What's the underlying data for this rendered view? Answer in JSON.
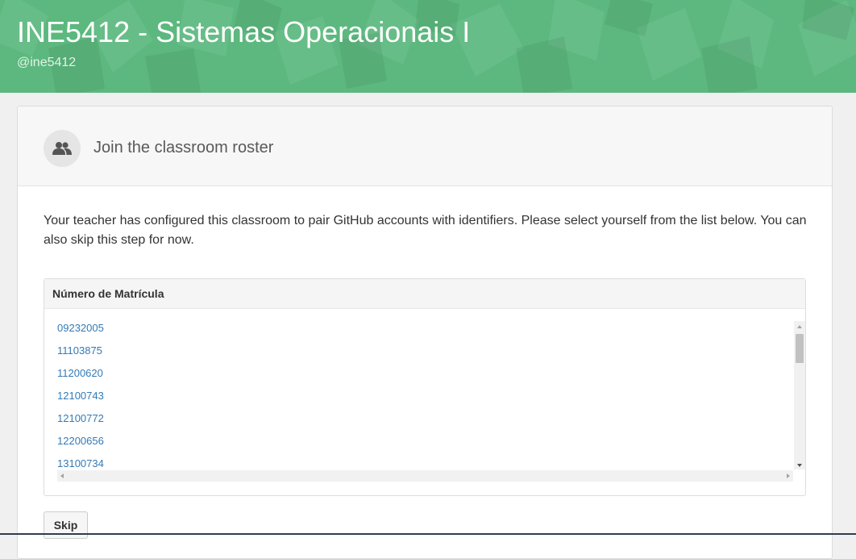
{
  "header": {
    "org_title": "INE5412 - Sistemas Operacionais I",
    "org_handle": "@ine5412",
    "banner_color": "#5cb87e"
  },
  "roster": {
    "icon": "people-icon",
    "title": "Join the classroom roster",
    "intro": "Your teacher has configured this classroom to pair GitHub accounts with identifiers. Please select yourself from the list below. You can also skip this step for now.",
    "panel_title": "Número de Matrícula",
    "identifiers": [
      "09232005",
      "11103875",
      "11200620",
      "12100743",
      "12100772",
      "12200656",
      "13100734"
    ],
    "link_color": "#337ab7",
    "skip_label": "Skip"
  }
}
